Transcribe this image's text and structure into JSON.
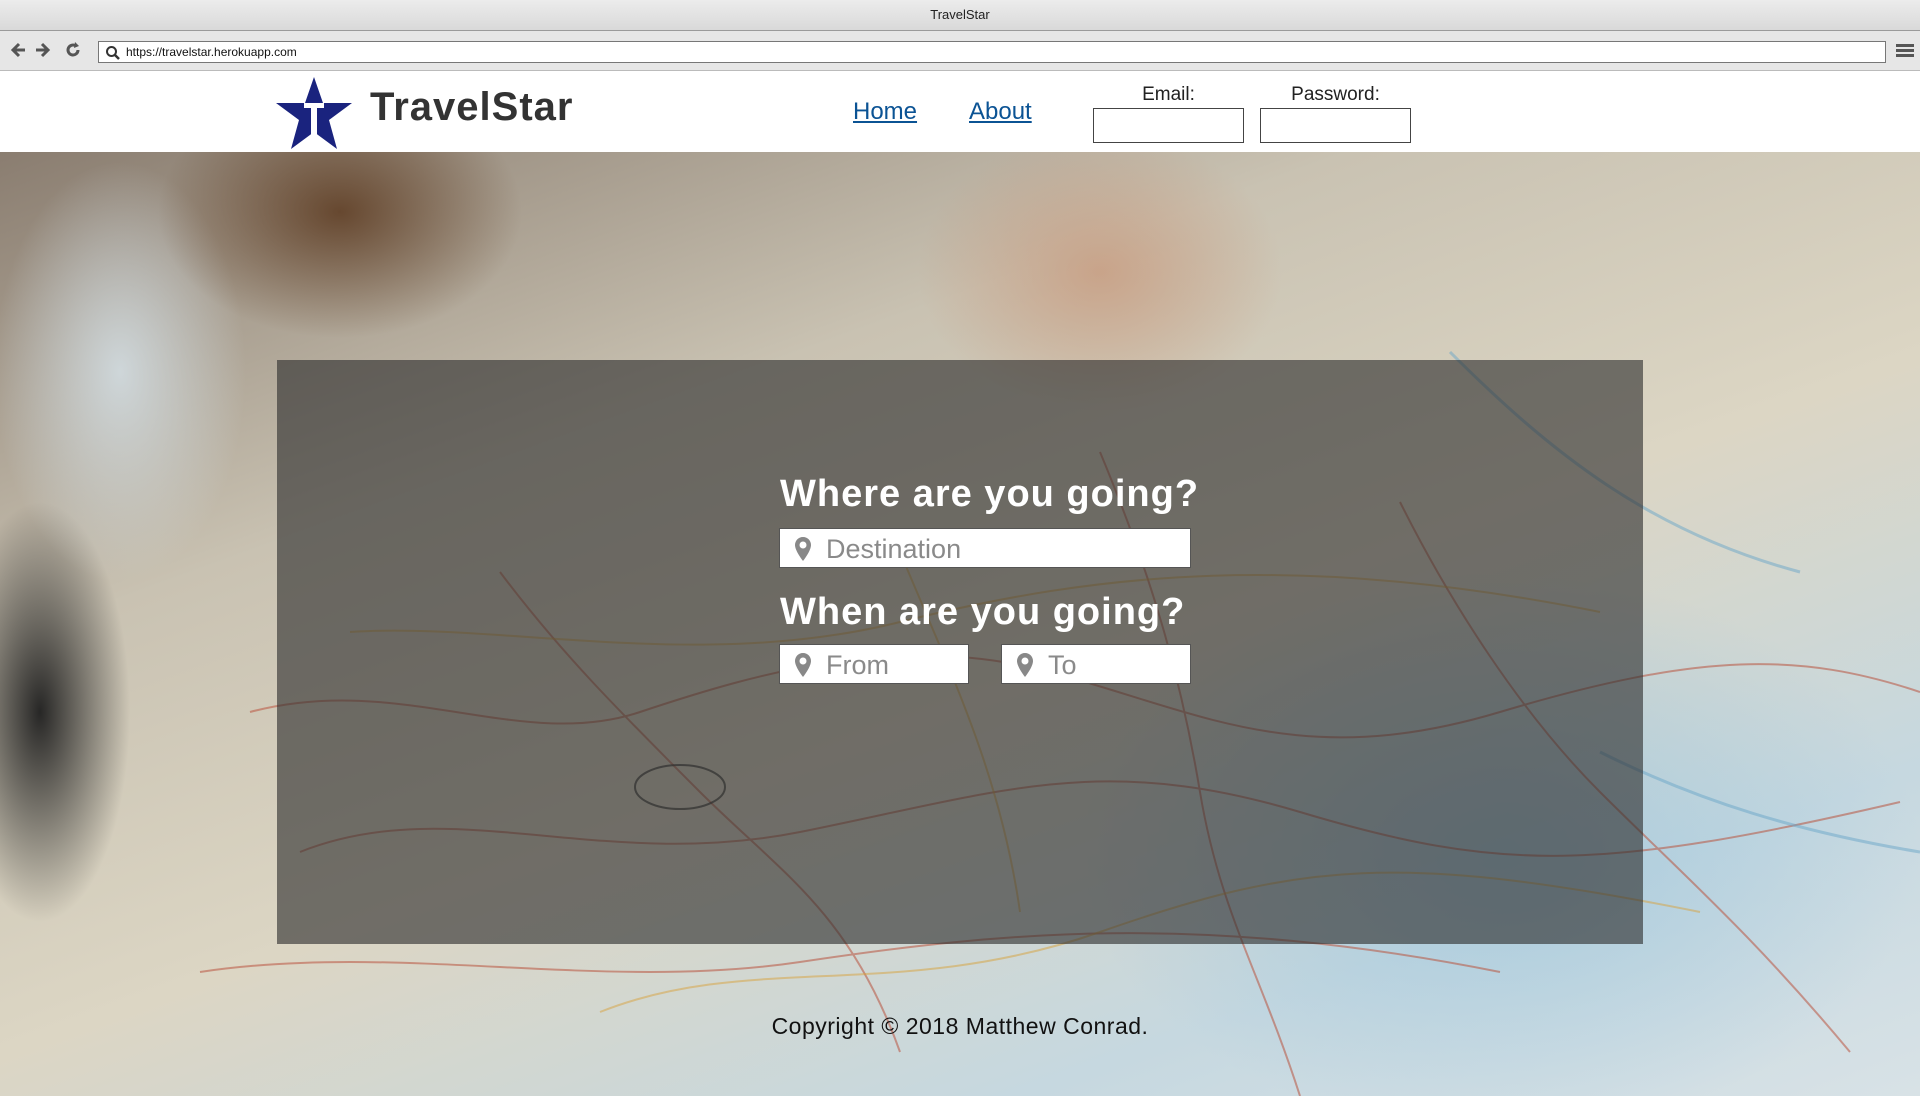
{
  "browser": {
    "window_title": "TravelStar",
    "url": "https://travelstar.herokuapp.com",
    "icons": [
      "back-arrow-icon",
      "forward-arrow-icon",
      "reload-icon",
      "search-icon",
      "hamburger-menu-icon"
    ]
  },
  "header": {
    "brand": "TravelStar",
    "logo_color": "#1a237e",
    "nav": [
      {
        "label": "Home"
      },
      {
        "label": "About"
      }
    ],
    "login": {
      "email_label": "Email:",
      "email_value": "",
      "password_label": "Password:",
      "password_value": ""
    },
    "link_color": "#0b5394"
  },
  "search": {
    "where_heading": "Where are you going?",
    "destination_placeholder": "Destination",
    "when_heading": "When are you going?",
    "from_placeholder": "From",
    "to_placeholder": "To",
    "field_icon": "map-pin-icon"
  },
  "footer": {
    "copyright": "Copyright © 2018 Matthew Conrad."
  }
}
